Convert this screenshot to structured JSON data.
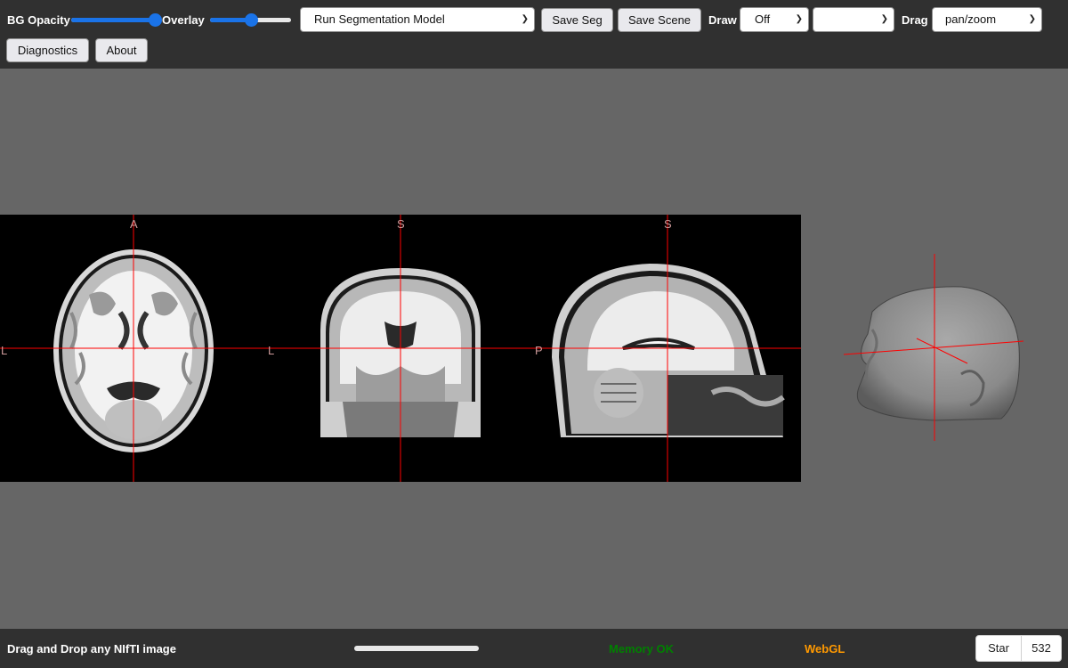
{
  "toolbar": {
    "bg_opacity_label": "BG Opacity",
    "bg_opacity_value": 1.0,
    "overlay_label": "Overlay",
    "overlay_value": 0.5,
    "model_select_value": "Run Segmentation Model",
    "save_seg_label": "Save Seg",
    "save_scene_label": "Save Scene",
    "draw_label": "Draw",
    "draw_select_value": "Off",
    "draw_color_select_value": "",
    "drag_label": "Drag",
    "drag_select_value": "pan/zoom",
    "diagnostics_label": "Diagnostics",
    "about_label": "About"
  },
  "views": {
    "axial": {
      "top": "A",
      "left": "L"
    },
    "coronal": {
      "top": "S",
      "left": "L"
    },
    "sagittal": {
      "top": "S",
      "left": "P"
    }
  },
  "footer": {
    "status_text": "Drag and Drop any NIfTI image",
    "progress": 0,
    "memory_text": "Memory OK",
    "memory_color": "#008000",
    "webgl_text": "WebGL",
    "webgl_color": "#ff9900",
    "star_label": "Star",
    "star_count": "532"
  },
  "colors": {
    "accent": "#1a73e8",
    "crosshair": "#ff0000",
    "toolbar_bg": "#303030",
    "page_bg": "#666666"
  }
}
